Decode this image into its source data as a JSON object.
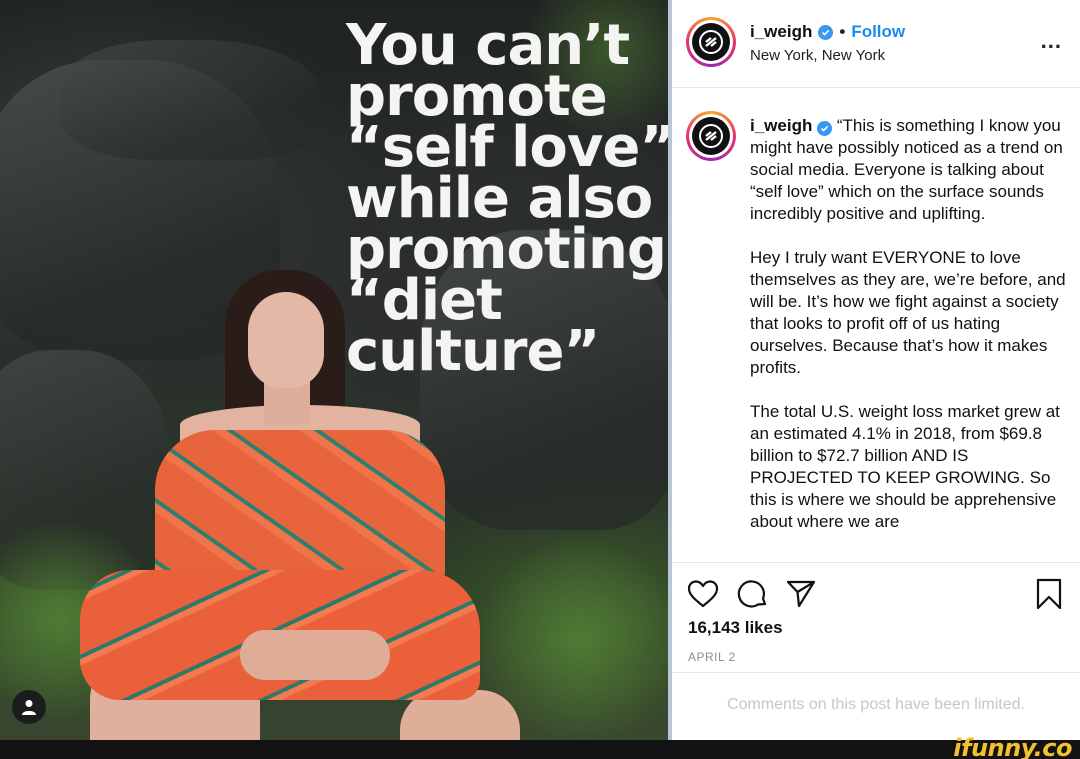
{
  "post_image": {
    "quote_lines": [
      "You can’t",
      "promote",
      "“self love”",
      "while also",
      "promoting",
      "“diet",
      "culture”"
    ],
    "user_tag_icon": "user-silhouette-icon"
  },
  "header": {
    "username": "i_weigh",
    "separator": "•",
    "follow_label": "Follow",
    "location": "New York, New York",
    "more_label": "...",
    "avatar_icon": "i-weigh-logo-icon",
    "verified_icon": "verified-badge-icon"
  },
  "caption": {
    "username": "i_weigh",
    "paragraphs": [
      "“This is something I know you might have possibly noticed as a trend on social media. Everyone is talking about “self love” which on the surface sounds incredibly positive and uplifting.",
      "Hey I truly want EVERYONE to love themselves as they are, we’re before, and will be. It’s how we fight against a society that looks to profit off of us hating ourselves. Because that’s how it makes profits.",
      "The total U.S. weight loss market grew at an estimated 4.1% in 2018, from $69.8 billion to $72.7 billion AND IS PROJECTED TO KEEP GROWING. So this is where we should be apprehensive about where we are"
    ]
  },
  "actions": {
    "icons": [
      "heart-icon",
      "comment-icon",
      "share-icon",
      "bookmark-icon"
    ],
    "likes": "16,143 likes",
    "date": "APRIL 2"
  },
  "comments_limited": "Comments on this post have been limited.",
  "watermark": "ifunny.co",
  "colors": {
    "follow": "#1a8cf0",
    "verified": "#3897f0",
    "dress": "#e8643c",
    "watermark": "#f2c12e"
  }
}
